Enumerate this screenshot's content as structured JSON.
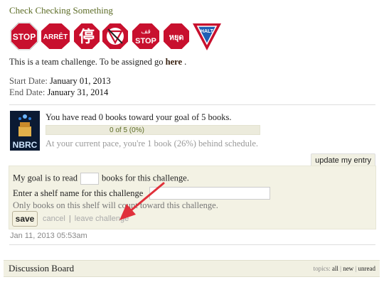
{
  "page": {
    "title": "Check Checking Something"
  },
  "stop_signs": [
    {
      "text": "STOP",
      "shape": "octagon",
      "color": "#c8102e"
    },
    {
      "text": "ARRÊT",
      "shape": "octagon",
      "color": "#c8102e"
    },
    {
      "text": "停",
      "shape": "octagon",
      "color": "#c8102e"
    },
    {
      "text": "",
      "shape": "octagon-no-entry",
      "color": "#c8102e"
    },
    {
      "text": "قف STOP",
      "shape": "octagon",
      "color": "#c8102e"
    },
    {
      "text": "หยุด",
      "shape": "octagon",
      "color": "#c8102e"
    },
    {
      "text": "HALT",
      "shape": "triangle",
      "color": "#c8102e"
    }
  ],
  "team": {
    "prefix": "This is a team challenge. To be assigned go",
    "link": "here",
    "suffix": "."
  },
  "dates": {
    "start_label": "Start Date:",
    "start_value": "January 01, 2013",
    "end_label": "End Date:",
    "end_value": "January 31, 2014"
  },
  "cover": {
    "text": "NBRC"
  },
  "progress": {
    "summary": "You have read 0 books toward your goal of 5 books.",
    "label": "0 of 5 (0%)",
    "fraction": 0,
    "pace": "At your current pace, you're 1 book (26%) behind schedule."
  },
  "edit": {
    "update_button": "update my entry",
    "goal_prefix": "My goal is to read",
    "goal_value": "",
    "goal_suffix": "books for this challenge.",
    "shelf_label": "Enter a shelf name for this challenge",
    "shelf_value": "",
    "only_note": "Only books on this shelf will count toward this challenge.",
    "save_button": "save",
    "cancel_link": "cancel",
    "separator": "|",
    "leave_link": "leave challenge",
    "timestamp": "Jan 11, 2013 05:53am"
  },
  "discussion": {
    "title": "Discussion Board",
    "topics_label": "topics:",
    "topics_all": "all",
    "topics_new": "new",
    "topics_unread": "unread",
    "topics_sep": "|"
  },
  "colors": {
    "accent": "#5b6b24",
    "sign_red": "#c8102e",
    "arrow_red": "#e0313b",
    "panel_bg": "#f3f2e4"
  }
}
